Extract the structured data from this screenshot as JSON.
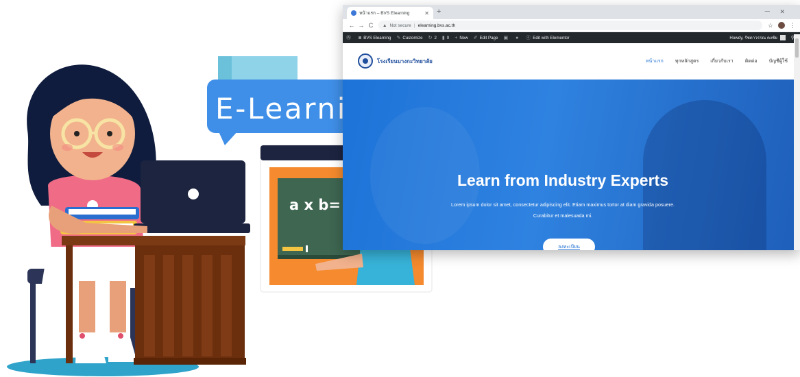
{
  "illustration": {
    "bubble_text": "E-Learning",
    "board_text": "a x b= c"
  },
  "browser": {
    "tab_title": "หน้าแรก – BVS Elearning",
    "new_tab_icon": "plus-icon",
    "address_warning": "Not secure",
    "address_url": "elearning.bvs.ac.th"
  },
  "wp_admin_bar": {
    "items": [
      {
        "icon": "wordpress-logo-icon",
        "label": ""
      },
      {
        "icon": "dashboard-icon",
        "label": "BVS Elearning"
      },
      {
        "icon": "brush-icon",
        "label": "Customize"
      },
      {
        "icon": "updates-icon",
        "label": "2"
      },
      {
        "icon": "comment-icon",
        "label": "0"
      },
      {
        "icon": "plus-icon",
        "label": "New"
      },
      {
        "icon": "pencil-icon",
        "label": "Edit Page"
      },
      {
        "icon": "plugin-icon",
        "label": ""
      },
      {
        "icon": "circle-icon",
        "label": ""
      },
      {
        "icon": "elementor-icon",
        "label": "Edit with Elementor"
      }
    ],
    "howdy": "Howdy, รัชดาวรรณ คงชัย"
  },
  "site": {
    "logo_name": "โรงเรียนบางกะวิทยาลัย",
    "nav": [
      "หน้าแรก",
      "ทุกหลักสูตร",
      "เกี่ยวกับเรา",
      "ติดต่อ",
      "บัญชีผู้ใช้"
    ],
    "active_nav_index": 0
  },
  "hero": {
    "title": "Learn from Industry Experts",
    "description_line1": "Lorem ipsum dolor sit amet, consectetur adipiscing elit. Etiam maximus tortor at diam gravida posuere.",
    "description_line2": "Curabitur et malesuada mi.",
    "cta_label": "ลงทะเบียน"
  },
  "colors": {
    "hero_blue": "#1d73d8",
    "wp_bar": "#23282d",
    "bubble_blue": "#3f8fe8",
    "chalkboard": "#3e6651",
    "desk_brown": "#7b3a14"
  }
}
